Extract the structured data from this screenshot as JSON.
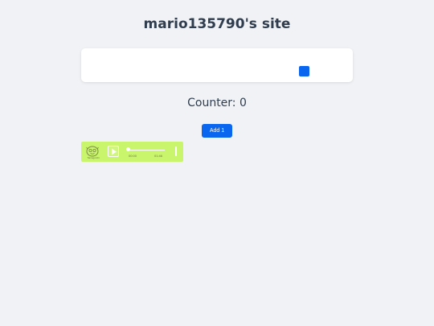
{
  "header": {
    "title": "mario135790's site"
  },
  "counter": {
    "text": "Counter: 0",
    "add_label": "Add 1"
  },
  "player": {
    "caption": "Tamagotchi",
    "current_time": "00:00",
    "total_time": "01:46",
    "progress": 0,
    "background_color": "#c8f56c"
  },
  "colors": {
    "accent": "#0a66ee",
    "page_background": "#f0f2f5",
    "text": "#2f3d4f"
  },
  "icons": {
    "card_widget": "blue-square-icon",
    "player_avatar": "face-icon",
    "player_play": "play-icon"
  }
}
